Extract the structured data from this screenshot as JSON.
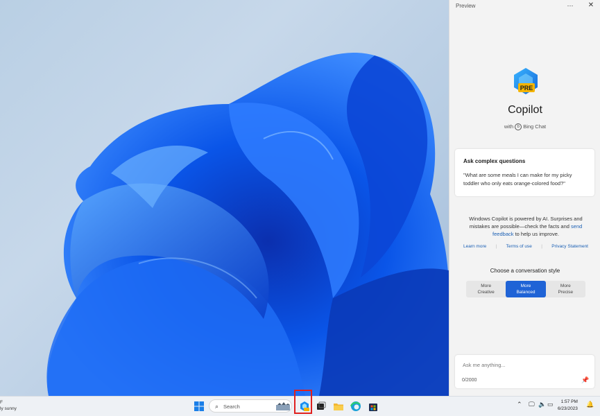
{
  "pane": {
    "title": "Preview",
    "more_icon": "ellipsis-icon",
    "close_icon": "close-icon",
    "app_name": "Copilot",
    "logo_badge": "PRE",
    "with_prefix": "with",
    "with_brand": "Bing Chat",
    "card": {
      "title": "Ask complex questions",
      "text": "\"What are some meals I can make for my picky toddler who only eats orange-colored food?\""
    },
    "disclaimer_main": "Windows Copilot is powered by AI. Surprises and mistakes are possible—check the facts and ",
    "disclaimer_link": "send feedback",
    "disclaimer_tail": " to help us improve.",
    "links": [
      "Learn more",
      "Terms of use",
      "Privacy Statement"
    ],
    "style_title": "Choose a conversation style",
    "styles": [
      {
        "line1": "More",
        "line2": "Creative"
      },
      {
        "line1": "More",
        "line2": "Balanced"
      },
      {
        "line1": "More",
        "line2": "Precise"
      }
    ],
    "selected_style": "More Balanced",
    "input_placeholder": "Ask me anything...",
    "counter": "0/2000"
  },
  "taskbar": {
    "weather_line1": "F",
    "weather_line2": "ly sunny",
    "search_placeholder": "Search",
    "time": "1:57 PM",
    "date": "6/23/2023"
  },
  "colors": {
    "accent": "#1f63d6",
    "highlight": "#e0201e",
    "bloom": "#0a5cf0"
  }
}
